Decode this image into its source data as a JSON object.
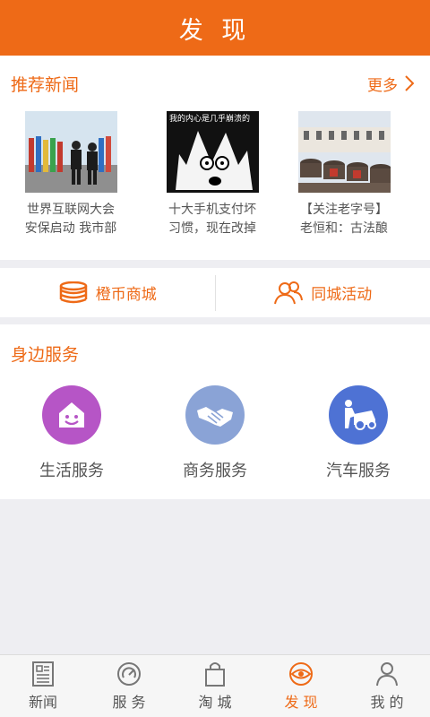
{
  "header": {
    "title": "发 现"
  },
  "news": {
    "title": "推荐新闻",
    "more_label": "更多",
    "items": [
      {
        "line1": "世界互联网大会",
        "line2": "安保启动 我市部"
      },
      {
        "line1": "十大手机支付坏",
        "line2": "习惯，现在改掉",
        "image_text": "我的内心是几乎崩溃的"
      },
      {
        "line1": "【关注老字号】",
        "line2": "老恒和：古法酿"
      }
    ]
  },
  "links": [
    {
      "label": "橙币商城",
      "icon": "coins-icon"
    },
    {
      "label": "同城活动",
      "icon": "people-icon"
    }
  ],
  "services": {
    "title": "身边服务",
    "items": [
      {
        "label": "生活服务",
        "icon": "house-smile-icon",
        "color": "#b655c6"
      },
      {
        "label": "商务服务",
        "icon": "handshake-icon",
        "color": "#8aa3d6"
      },
      {
        "label": "汽车服务",
        "icon": "car-repair-icon",
        "color": "#4e72d4"
      }
    ]
  },
  "tabs": [
    {
      "label": "新闻",
      "icon": "newspaper-icon",
      "active": false
    },
    {
      "label": "服 务",
      "icon": "service-gauge-icon",
      "active": false
    },
    {
      "label": "淘 城",
      "icon": "shopping-bag-icon",
      "active": false
    },
    {
      "label": "发 现",
      "icon": "eye-icon",
      "active": true
    },
    {
      "label": "我 的",
      "icon": "person-icon",
      "active": false
    }
  ],
  "colors": {
    "accent": "#ee6a17",
    "background": "#eeeef2"
  }
}
